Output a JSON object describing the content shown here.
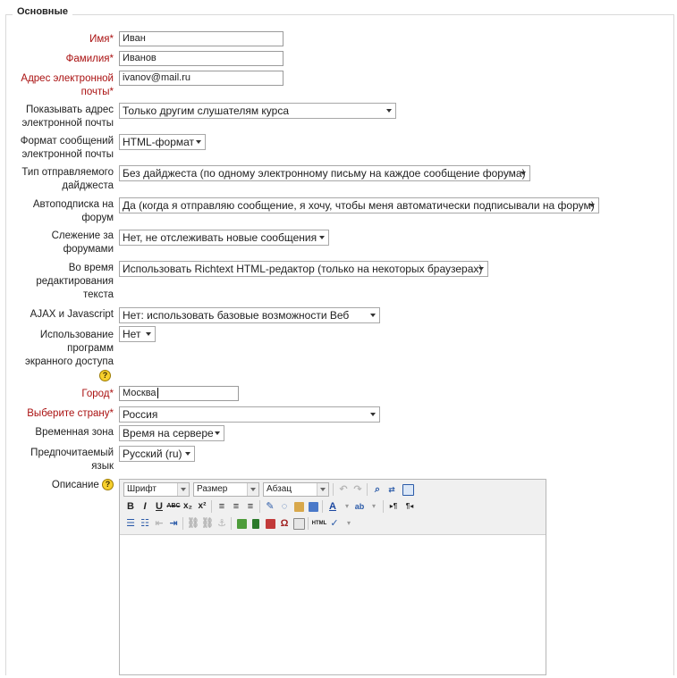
{
  "fieldset": {
    "legend": "Основные"
  },
  "fields": {
    "first_name": {
      "label": "Имя",
      "value": "Иван"
    },
    "last_name": {
      "label": "Фамилия",
      "value": "Иванов"
    },
    "email": {
      "label_line1": "Адрес электронной",
      "label_line2": "почты",
      "value": "ivanov@mail.ru"
    },
    "show_email": {
      "label_line1": "Показывать адрес",
      "label_line2": "электронной почты",
      "value": "Только другим слушателям курса"
    },
    "mail_format": {
      "label_line1": "Формат сообщений",
      "label_line2": "электронной почты",
      "value": "HTML-формат"
    },
    "digest": {
      "label_line1": "Тип отправляемого",
      "label_line2": "дайджеста",
      "value": "Без дайджеста (по одному электронному письму на каждое сообщение форума)"
    },
    "autosubscribe": {
      "label_line1": "Автоподписка на",
      "label_line2": "форум",
      "value": "Да (когда я отправляю сообщение, я хочу, чтобы меня автоматически подписывали на форум)"
    },
    "tracking": {
      "label_line1": "Слежение за",
      "label_line2": "форумами",
      "value": "Нет, не отслеживать новые сообщения"
    },
    "editing": {
      "label_line1": "Во время",
      "label_line2": "редактирования",
      "label_line3": "текста",
      "value": "Использовать Richtext HTML-редактор (только на некоторых браузерах)"
    },
    "ajax": {
      "label": "AJAX и Javascript",
      "value": "Нет: использовать базовые возможности Веб"
    },
    "screenreader": {
      "label_line1": "Использование",
      "label_line2": "программ",
      "label_line3": "экранного доступа",
      "value": "Нет"
    },
    "city": {
      "label": "Город",
      "value": "Москва"
    },
    "country": {
      "label": "Выберите страну",
      "value": "Россия"
    },
    "timezone": {
      "label": "Временная зона",
      "value": "Время на сервере"
    },
    "language": {
      "label_line1": "Предпочитаемый",
      "label_line2": "язык",
      "value": "Русский (ru)"
    },
    "description": {
      "label": "Описание"
    }
  },
  "required_marker": "*",
  "help_glyph": "?",
  "editor": {
    "font_dd": "Шрифт",
    "size_dd": "Размер",
    "format_dd": "Абзац",
    "bold": "B",
    "italic": "I",
    "underline": "U",
    "strike": "ABC",
    "subscript": "x₂",
    "superscript": "x²",
    "html_label": "HTML",
    "omega": "Ω"
  },
  "colors": {
    "required": "#aa1111",
    "help": "#f7d02c",
    "border": "#d9d9d9"
  }
}
